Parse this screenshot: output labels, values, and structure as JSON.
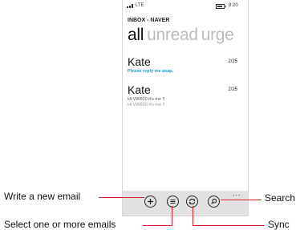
{
  "status_bar": {
    "network": "LTE",
    "time": "8:20"
  },
  "account_title": "INBOX - NAVER",
  "pivots": {
    "active": "all",
    "items": [
      "unread",
      "urge"
    ]
  },
  "messages": [
    {
      "sender": "Kate",
      "date": "2/25",
      "preview": "Please reply me asap."
    },
    {
      "sender": "Kate",
      "date": "2/25",
      "preview": "Hi VW820 it's me !!",
      "preview2": "Hi VW820 it's me !!"
    }
  ],
  "app_bar": {
    "buttons": [
      {
        "icon": "plus-icon"
      },
      {
        "icon": "list-icon"
      },
      {
        "icon": "sync-icon"
      },
      {
        "icon": "search-icon"
      }
    ],
    "more": "..."
  },
  "callouts": {
    "new_email": "Write a new email",
    "select": "Select one or more emails",
    "search": "Search",
    "sync": "Sync"
  },
  "colors": {
    "accent": "#1aa0cf",
    "callout_line": "#e0202a",
    "app_bar": "#e2e2e2"
  }
}
